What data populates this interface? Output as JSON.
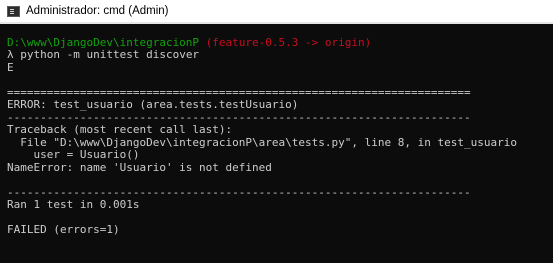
{
  "window": {
    "title": "Administrador: cmd (Admin)",
    "icon": "console-icon"
  },
  "colors": {
    "background": "#0c0c0c",
    "text": "#cccccc",
    "path": "#13a10e",
    "branch": "#c50f1f"
  },
  "console": {
    "prompt_path": "D:\\www\\DjangoDev\\integracionP",
    "prompt_branch": "(feature-0.5.3 -> origin)",
    "prompt_symbol": "λ",
    "command": "python -m unittest discover",
    "lines": {
      "result_marker": "E",
      "separator_double": "======================================================================",
      "error_header": "ERROR: test_usuario (area.tests.testUsuario)",
      "separator_single": "----------------------------------------------------------------------",
      "traceback_header": "Traceback (most recent call last):",
      "traceback_file": "  File \"D:\\www\\DjangoDev\\integracionP\\area\\tests.py\", line 8, in test_usuario",
      "traceback_code": "    user = Usuario()",
      "exception": "NameError: name 'Usuario' is not defined",
      "separator_single_2": "----------------------------------------------------------------------",
      "summary": "Ran 1 test in 0.001s",
      "status": "FAILED (errors=1)"
    }
  }
}
